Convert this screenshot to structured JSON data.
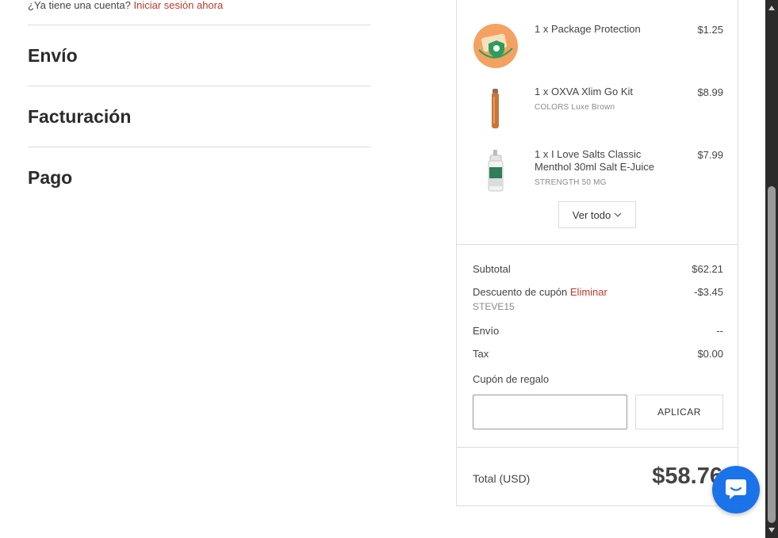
{
  "account": {
    "prompt": "¿Ya tiene una cuenta?",
    "login_link": "Iniciar sesión ahora"
  },
  "sections": [
    "Envío",
    "Facturación",
    "Pago"
  ],
  "items": [
    {
      "name": "1 x Package Protection",
      "variant": "",
      "price": "$1.25",
      "icon": "package-protection-icon"
    },
    {
      "name": "1 x OXVA Xlim Go Kit",
      "variant": "COLORS Luxe Brown",
      "price": "$8.99",
      "icon": "vape-pod-icon"
    },
    {
      "name": "1 x I Love Salts Classic Menthol 30ml Salt E-Juice",
      "variant": "STRENGTH 50 MG",
      "price": "$7.99",
      "icon": "e-juice-bottle-icon"
    }
  ],
  "view_all": "Ver todo",
  "summary": {
    "subtotal_label": "Subtotal",
    "subtotal_value": "$62.21",
    "discount_label": "Descuento de cupón",
    "discount_remove": "Eliminar",
    "discount_code": "STEVE15",
    "discount_value": "-$3.45",
    "shipping_label": "Envío",
    "shipping_value": "--",
    "tax_label": "Tax",
    "tax_value": "$0.00"
  },
  "gift": {
    "label": "Cupón de regalo",
    "input_value": "",
    "apply_label": "APLICAR"
  },
  "total": {
    "label": "Total (USD)",
    "value": "$58.76"
  },
  "colors": {
    "link": "#c0392b",
    "chat": "#1a73e8",
    "border": "#dcdcdc"
  }
}
